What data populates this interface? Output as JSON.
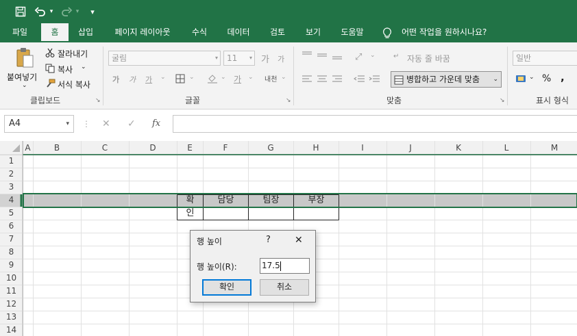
{
  "qat": {
    "customize_glyph": "▾"
  },
  "tabs": [
    "파일",
    "홈",
    "삽입",
    "페이지 레이아웃",
    "수식",
    "데이터",
    "검토",
    "보기",
    "도움말"
  ],
  "tell_me": "어떤 작업을 원하시나요?",
  "ribbon": {
    "clipboard": {
      "paste": "붙여넣기",
      "cut": "잘라내기",
      "copy": "복사",
      "format_painter": "서식 복사",
      "label": "클립보드"
    },
    "font": {
      "font_name": "굴림",
      "font_size": "11",
      "label": "글꼴",
      "grow": "가",
      "shrink": "가",
      "bold": "가",
      "italic": "가",
      "underline": "가",
      "font_color": "가",
      "phonetic": "내천"
    },
    "alignment": {
      "wrap_text": "자동 줄 바꿈",
      "merge_center": "병합하고 가운데 맞춤",
      "label": "맞춤"
    },
    "number": {
      "format": "일반",
      "percent": "%",
      "comma": ",",
      "label": "표시 형식"
    }
  },
  "formula_bar": {
    "name_box": "A4",
    "fx": "fx",
    "value": ""
  },
  "grid": {
    "columns": [
      "A",
      "B",
      "C",
      "D",
      "E",
      "F",
      "G",
      "H",
      "I",
      "J",
      "K",
      "L",
      "M"
    ],
    "rows": [
      "1",
      "2",
      "3",
      "4",
      "5",
      "6",
      "7",
      "8",
      "9",
      "10",
      "11",
      "12",
      "13",
      "14"
    ],
    "cells": {
      "E4": "확",
      "E5": "인",
      "F4": "담당",
      "G4": "팀장",
      "H4": "부장"
    }
  },
  "dialog": {
    "title": "행 높이",
    "help": "?",
    "close": "✕",
    "field_label": "행 높이(R):",
    "field_value": "17.5",
    "ok": "확인",
    "cancel": "취소"
  },
  "colors": {
    "excel_green": "#217346",
    "selection_row": "#c8c8c8",
    "dialog_focus": "#0078d7"
  }
}
